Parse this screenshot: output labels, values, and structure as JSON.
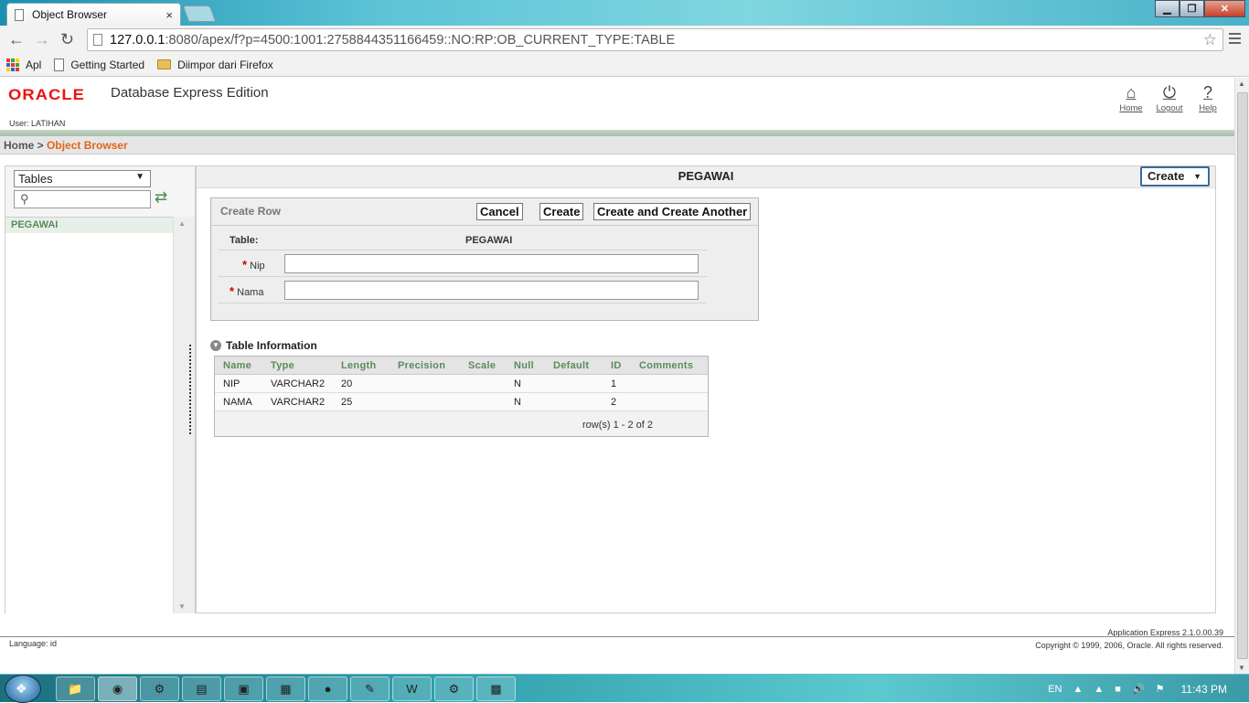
{
  "browser": {
    "tab_title": "Object Browser",
    "tab_close": "×",
    "url_host": "127.0.0.1",
    "url_rest": ":8080/apex/f?p=4500:1001:2758844351166459::NO:RP:OB_CURRENT_TYPE:TABLE",
    "window_controls": {
      "minimize": "▁",
      "maximize": "❐",
      "close": "✕"
    }
  },
  "bookmarks": [
    {
      "label": "Apl",
      "icon": "apps-icon"
    },
    {
      "label": "Getting Started",
      "icon": "page-icon"
    },
    {
      "label": "Diimpor dari Firefox",
      "icon": "folder-icon"
    }
  ],
  "header": {
    "logo_text": "ORACLE",
    "product": "Database Express Edition",
    "user_line": "User: LATIHAN",
    "links": [
      {
        "label": "Home",
        "icon": "home-icon",
        "glyph": "⌂"
      },
      {
        "label": "Logout",
        "icon": "power-icon",
        "glyph": "⏻"
      },
      {
        "label": "Help",
        "icon": "help-icon",
        "glyph": "?"
      }
    ]
  },
  "breadcrumb": {
    "home": "Home",
    "sep": " > ",
    "current": "Object Browser"
  },
  "left_panel": {
    "object_type": "Tables",
    "search_value": "",
    "objects": [
      "PEGAWAI"
    ]
  },
  "main": {
    "object_name": "PEGAWAI",
    "create_menu_label": "Create",
    "form": {
      "title": "Create Row",
      "buttons": {
        "cancel": "Cancel",
        "create": "Create",
        "create_another": "Create and Create Another"
      },
      "table_label": "Table:",
      "table_value": "PEGAWAI",
      "fields": [
        {
          "label": "Nip",
          "required": true,
          "value": ""
        },
        {
          "label": "Nama",
          "required": true,
          "value": ""
        }
      ]
    },
    "table_info": {
      "title": "Table Information",
      "columns": [
        "Name",
        "Type",
        "Length",
        "Precision",
        "Scale",
        "Null",
        "Default",
        "ID",
        "Comments"
      ],
      "rows": [
        [
          "NIP",
          "VARCHAR2",
          "20",
          "",
          "",
          "N",
          "",
          "1",
          ""
        ],
        [
          "NAMA",
          "VARCHAR2",
          "25",
          "",
          "",
          "N",
          "",
          "2",
          ""
        ]
      ],
      "pagination": "row(s) 1 - 2 of 2"
    }
  },
  "footer": {
    "language": "Language: id",
    "version": "Application Express 2.1.0.00.39",
    "copyright": "Copyright © 1999, 2006, Oracle. All rights reserved."
  },
  "taskbar": {
    "tray_lang": "EN",
    "clock": "11:43 PM"
  },
  "colors": {
    "oracle_red": "#ee1111",
    "accent_green": "#5b8a5b",
    "breadcrumb_current": "#e0661a"
  }
}
